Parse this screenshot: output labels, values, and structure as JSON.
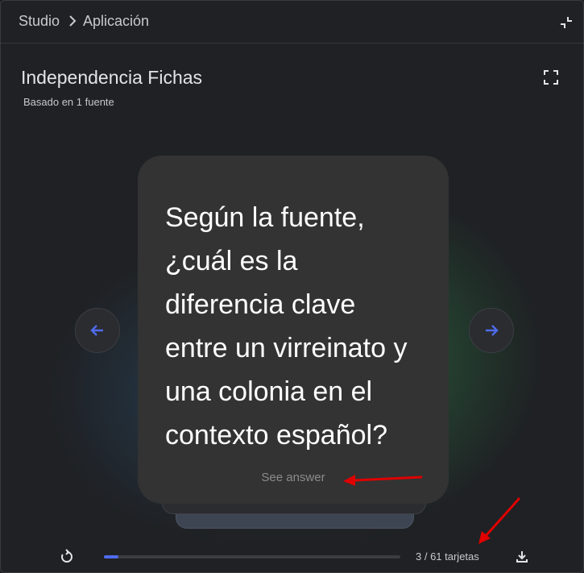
{
  "breadcrumb": {
    "root": "Studio",
    "current": "Aplicación"
  },
  "header": {
    "title": "Independencia Fichas",
    "subtitle": "Basado en 1 fuente"
  },
  "card": {
    "question": "Según la fuente, ¿cuál es la diferencia clave entre un virreinato y una colonia en el contexto español?",
    "see_answer": "See answer"
  },
  "progress": {
    "label": "3 / 61 tarjetas",
    "current": 3,
    "total": 61
  },
  "icons": {
    "breadcrumb_separator": "chevron-right-icon",
    "collapse": "collapse-icon",
    "expand": "fullscreen-icon",
    "prev": "arrow-left-icon",
    "next": "arrow-right-icon",
    "restart": "restart-icon",
    "download": "download-icon"
  },
  "colors": {
    "accent": "#4f6bed",
    "arrow_annotation": "#e00000",
    "card_background": "#333333"
  }
}
